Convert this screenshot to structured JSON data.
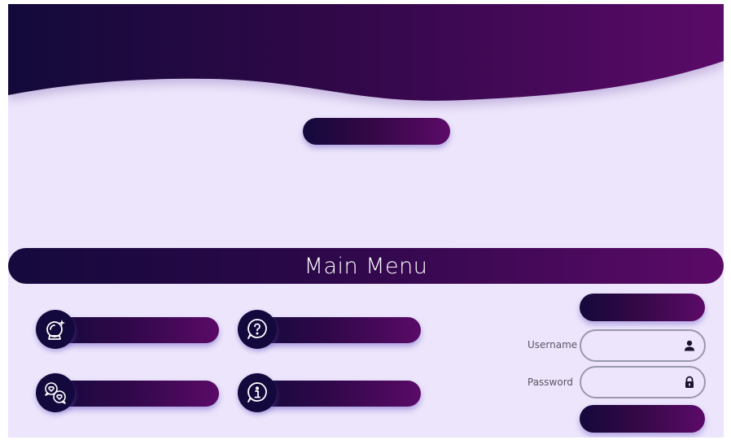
{
  "app": {
    "theme": {
      "background": "#ece5fb",
      "gradient_start": "#14093c",
      "gradient_end": "#5c0a68",
      "field_border": "#9a97ac"
    }
  },
  "header": {
    "top_button_label": ""
  },
  "menu": {
    "title": "Main Menu",
    "items": [
      {
        "label": "",
        "icon": "crystal-ball-icon"
      },
      {
        "label": "",
        "icon": "question-chat-icon"
      },
      {
        "label": "",
        "icon": "heart-chat-icon"
      },
      {
        "label": "",
        "icon": "info-chat-icon"
      }
    ]
  },
  "login": {
    "top_button_label": "",
    "username_label": "Username",
    "username_value": "",
    "password_label": "Password",
    "password_value": "",
    "submit_label": "",
    "username_icon": "user-icon",
    "password_icon": "lock-icon"
  }
}
